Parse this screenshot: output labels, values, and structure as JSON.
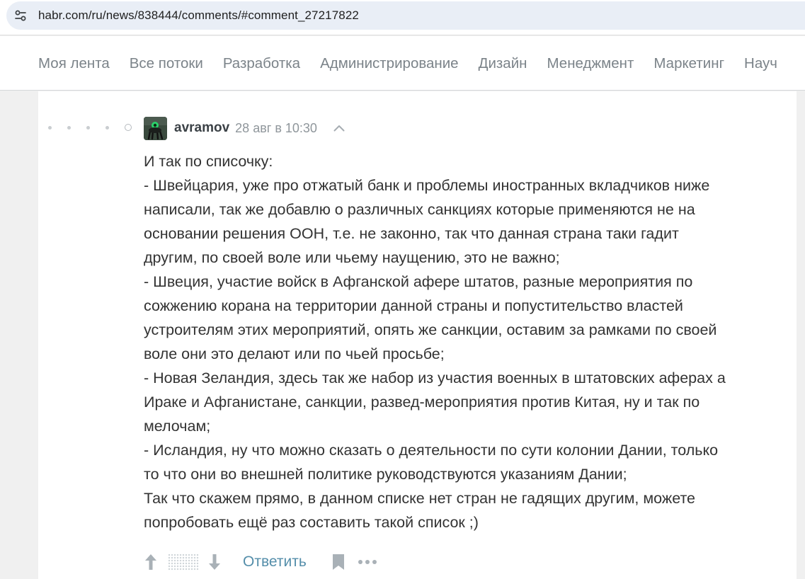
{
  "browser": {
    "url": "habr.com/ru/news/838444/comments/#comment_27217822"
  },
  "nav": {
    "items": [
      "Моя лента",
      "Все потоки",
      "Разработка",
      "Администрирование",
      "Дизайн",
      "Менеджмент",
      "Маркетинг",
      "Науч"
    ]
  },
  "comment": {
    "username": "avramov",
    "timestamp": "28 авг в 10:30",
    "lines": [
      "И так по списочку:",
      "- Швейцария, уже про отжатый банк и проблемы иностранных вкладчиков ниже",
      "написали, так же добавлю о различных санкциях которые применяются не на",
      "основании решения ООН, т.е. не законно, так что данная страна таки гадит",
      "другим, по своей воле или чьему наущению, это не важно;",
      "- Швеция, участие войск в Афганской афере штатов, разные мероприятия по",
      "сожжению корана на территории данной страны и попустительство властей",
      "устроителям этих мероприятий, опять же санкции, оставим за рамками по своей",
      "воле они это делают или по чьей просьбе;",
      "- Новая Зеландия, здесь так же набор из участия военных в штатовских аферах а",
      "Ираке и Афганистане, санкции, развед-мероприятия против Китая, ну и так по",
      "мелочам;",
      "- Исландия, ну что можно сказать о деятельности по сути колонии Дании, только",
      "то что они во внешней политике руководствуются указаниям Дании;",
      "Так что скажем прямо, в данном списке нет стран не гадящих другим, можете",
      "попробовать ещё раз составить такой список ;)"
    ],
    "reply_label": "Ответить"
  },
  "icons": {
    "site_settings": "tune-icon",
    "avatar": "user-avatar",
    "collapse": "chevron-up-icon",
    "upvote": "arrow-up-icon",
    "downvote": "arrow-down-icon",
    "bookmark": "bookmark-icon",
    "more": "more-horizontal-icon"
  },
  "colors": {
    "link": "#548eaa",
    "nav_text": "#7b8389",
    "body_text": "#333333"
  }
}
